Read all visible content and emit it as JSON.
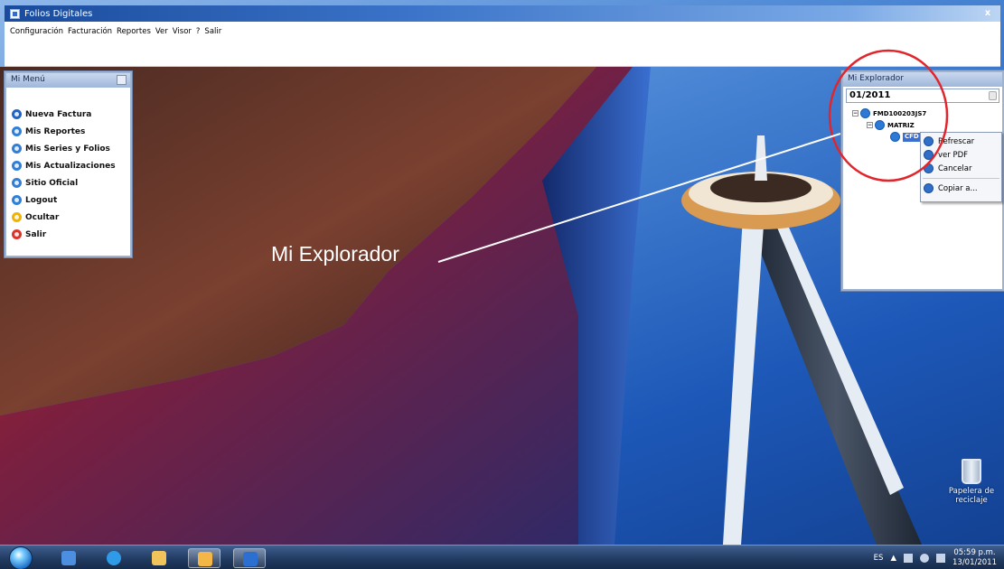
{
  "app": {
    "title": "Folios Digitales",
    "close_label": "x"
  },
  "menubar": {
    "items": [
      "Configuración",
      "Facturación",
      "Reportes",
      "Ver",
      "Visor",
      "?",
      "Salir"
    ]
  },
  "mi_menu": {
    "title": "Mi Menú",
    "items": [
      {
        "label": "Nueva Factura",
        "color": "#1f63c6"
      },
      {
        "label": "Mis Reportes",
        "color": "#2f7fd8"
      },
      {
        "label": "Mis Series y Folios",
        "color": "#2f7fd8"
      },
      {
        "label": "Mis Actualizaciones",
        "color": "#2f7fd8"
      },
      {
        "label": "Sitio Oficial",
        "color": "#2f7fd8"
      },
      {
        "label": "Logout",
        "color": "#2f7fd8"
      },
      {
        "label": "Ocultar",
        "color": "#f0b400"
      },
      {
        "label": "Salir",
        "color": "#d9342b"
      }
    ]
  },
  "explorer": {
    "title": "Mi Explorador",
    "period": "01/2011",
    "tree": {
      "root": "FMD100203JS7",
      "branch": "MATRIZ",
      "leaf": "CFD"
    },
    "context_menu": [
      "Refrescar",
      "ver PDF",
      "Cancelar",
      "Copiar a..."
    ]
  },
  "annotation": {
    "label": "Mi Explorador",
    "circle_color": "#e0262c"
  },
  "desktop": {
    "recycle_bin_label": "Papelera de reciclaje"
  },
  "taskbar": {
    "language": "ES",
    "time": "05:59 p.m.",
    "date": "13/01/2011"
  }
}
